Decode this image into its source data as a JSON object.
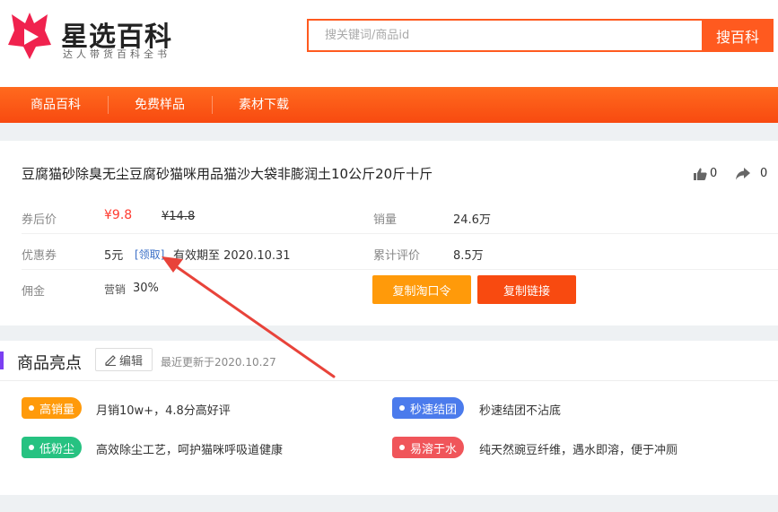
{
  "brand": {
    "name": "星选百科",
    "tagline": "达人带货百科全书"
  },
  "search": {
    "placeholder": "搜关键词/商品id",
    "button_label": "搜百科"
  },
  "nav": {
    "items": [
      "商品百科",
      "免费样品",
      "素材下载"
    ]
  },
  "product": {
    "title": "豆腐猫砂除臭无尘豆腐砂猫咪用品猫沙大袋非膨润土10公斤20斤十斤",
    "likes": "0",
    "shares": "0",
    "labels": {
      "price_after_coupon": "券后价",
      "coupon": "优惠券",
      "commission": "佣金",
      "sales": "销量",
      "reviews": "累计评价"
    },
    "price_after_coupon": "¥9.8",
    "original_price": "¥14.8",
    "coupon_value": "5元",
    "coupon_claim": "[领取]",
    "coupon_expiry": "有效期至 2020.10.31",
    "commission_type": "营销",
    "commission_rate": "30%",
    "sales": "24.6万",
    "reviews": "8.5万",
    "copy_taokouling_label": "复制淘口令",
    "copy_link_label": "复制链接"
  },
  "highlights": {
    "title": "商品亮点",
    "edit_label": "编辑",
    "updated": "最近更新于2020.10.27",
    "items": [
      {
        "tag": "高销量",
        "desc": "月销10w+，4.8分高好评",
        "color": "#ff9a0a"
      },
      {
        "tag": "秒速结团",
        "desc": "秒速结团不沾底",
        "color": "#4b7bec"
      },
      {
        "tag": "低粉尘",
        "desc": "高效除尘工艺，呵护猫咪呼吸道健康",
        "color": "#26c281"
      },
      {
        "tag": "易溶于水",
        "desc": "纯天然豌豆纤维，遇水即溶，便于冲厕",
        "color": "#f0555a"
      }
    ]
  },
  "colors": {
    "accent": "#ff5a1f",
    "price": "#ff3b30",
    "section_bar": "#7b3ff2"
  }
}
